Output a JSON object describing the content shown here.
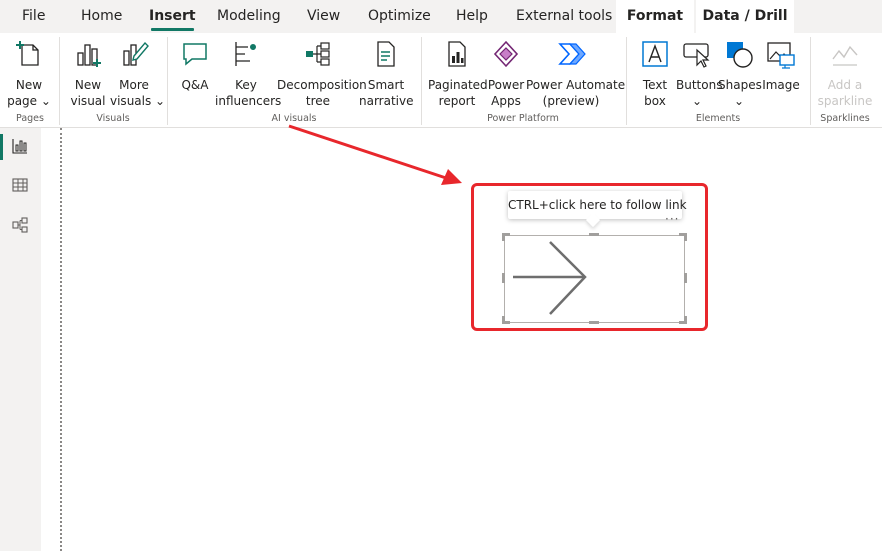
{
  "menu": {
    "tabs": [
      {
        "label": "File"
      },
      {
        "label": "Home"
      },
      {
        "label": "Insert"
      },
      {
        "label": "Modeling"
      },
      {
        "label": "View"
      },
      {
        "label": "Optimize"
      },
      {
        "label": "Help"
      },
      {
        "label": "External tools"
      },
      {
        "label": "Format"
      },
      {
        "label": "Data / Drill"
      }
    ],
    "active_tab": "Insert"
  },
  "ribbon": {
    "groups": {
      "pages": "Pages",
      "visuals": "Visuals",
      "ai_visuals": "AI visuals",
      "power_platform": "Power Platform",
      "elements": "Elements",
      "sparklines": "Sparklines"
    },
    "buttons": {
      "new_page": "New\npage ⌄",
      "new_visual": "New\nvisual",
      "more_visuals": "More\nvisuals ⌄",
      "qa": "Q&A",
      "key_influencers": "Key\ninfluencers",
      "decomposition_tree": "Decomposition\ntree",
      "smart_narrative": "Smart\nnarrative",
      "paginated_report": "Paginated\nreport",
      "power_apps": "Power\nApps",
      "power_automate": "Power Automate\n(preview)",
      "text_box": "Text\nbox",
      "buttons": "Buttons\n⌄",
      "shapes": "Shapes\n⌄",
      "image": "Image",
      "add_sparkline": "Add a\nsparkline"
    }
  },
  "canvas": {
    "tooltip_text": "CTRL+click here to follow link",
    "more_options": "···"
  },
  "colors": {
    "accent": "#117865",
    "highlight_red": "#e8272c",
    "menubar_bg": "#f3f2f1"
  }
}
